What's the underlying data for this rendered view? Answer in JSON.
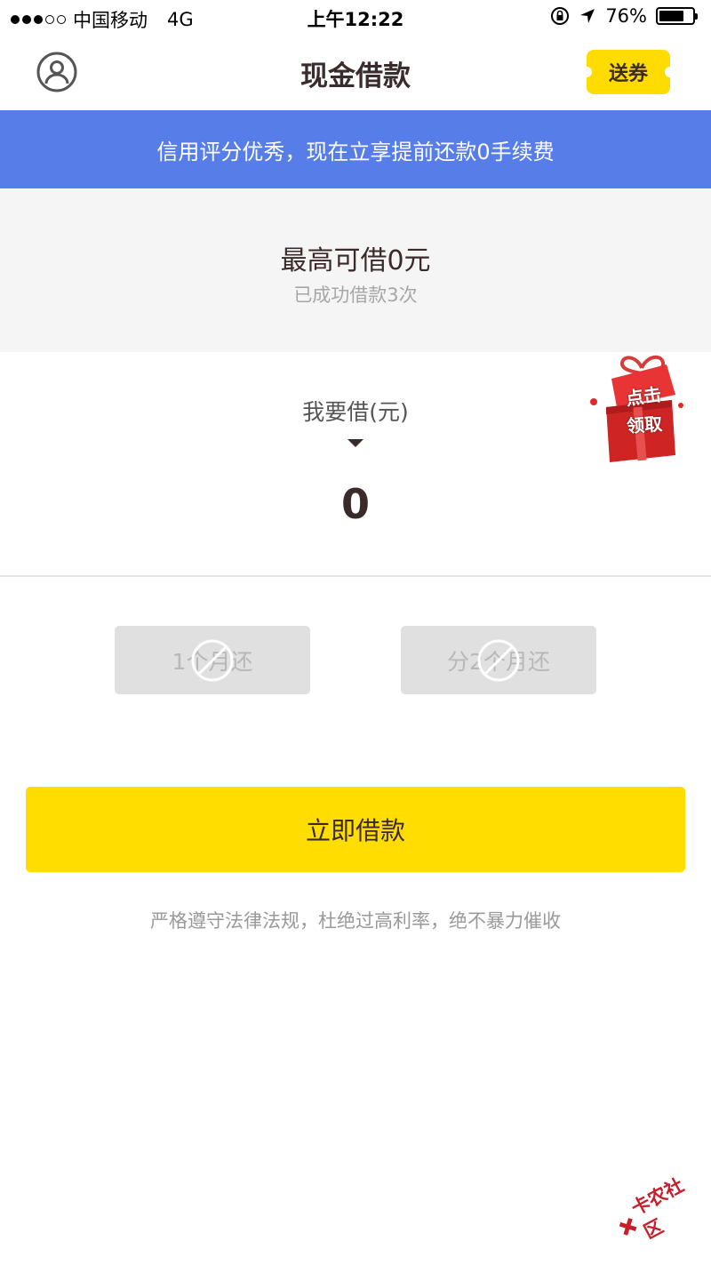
{
  "status_bar": {
    "carrier": "中国移动",
    "network": "4G",
    "time": "上午12:22",
    "battery": "76%",
    "battery_level": 0.76
  },
  "nav": {
    "title": "现金借款",
    "coupon_label": "送券"
  },
  "banner": {
    "text": "信用评分优秀，现在立享提前还款0手续费"
  },
  "credit": {
    "limit_text": "最高可借0元",
    "history_text": "已成功借款3次"
  },
  "borrow": {
    "label": "我要借(元)",
    "amount": "0"
  },
  "gift": {
    "line1": "点击",
    "line2": "领取"
  },
  "repay_options": [
    {
      "label": "1个月还"
    },
    {
      "label": "分2个月还"
    }
  ],
  "actions": {
    "borrow_label": "立即借款"
  },
  "disclaimer": "严格遵守法律法规，杜绝过高利率，绝不暴力催收",
  "watermark": "卡农社区",
  "colors": {
    "accent_yellow": "#ffdd00",
    "banner_blue": "#577de8",
    "gift_red": "#e02a2a"
  }
}
